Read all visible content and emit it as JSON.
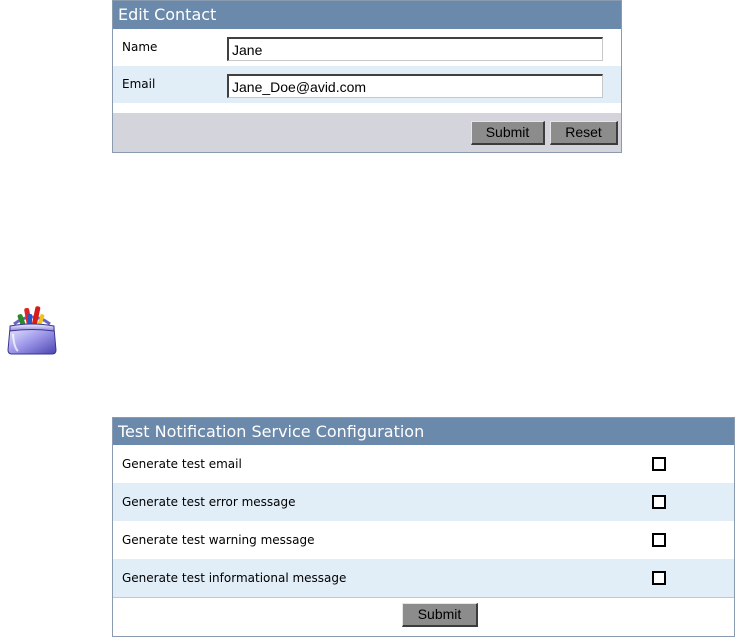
{
  "edit_contact": {
    "title": "Edit Contact",
    "fields": [
      {
        "label": "Name",
        "value": "Jane"
      },
      {
        "label": "Email",
        "value": "Jane_Doe@avid.com"
      }
    ],
    "buttons": {
      "submit": "Submit",
      "reset": "Reset"
    }
  },
  "toolbox": {
    "icon": "toolbox-icon"
  },
  "notification_config": {
    "title": "Test Notification Service Configuration",
    "rows": [
      {
        "label": "Generate test email",
        "checked": false
      },
      {
        "label": "Generate test error message",
        "checked": false
      },
      {
        "label": "Generate test warning message",
        "checked": false
      },
      {
        "label": "Generate test informational message",
        "checked": false
      }
    ],
    "submit": "Submit"
  },
  "colors": {
    "header_bg": "#6b89aa",
    "row_alt_bg": "#e1eef8",
    "footer_bg": "#d4d4dc",
    "button_bg": "#8c8c8c"
  }
}
